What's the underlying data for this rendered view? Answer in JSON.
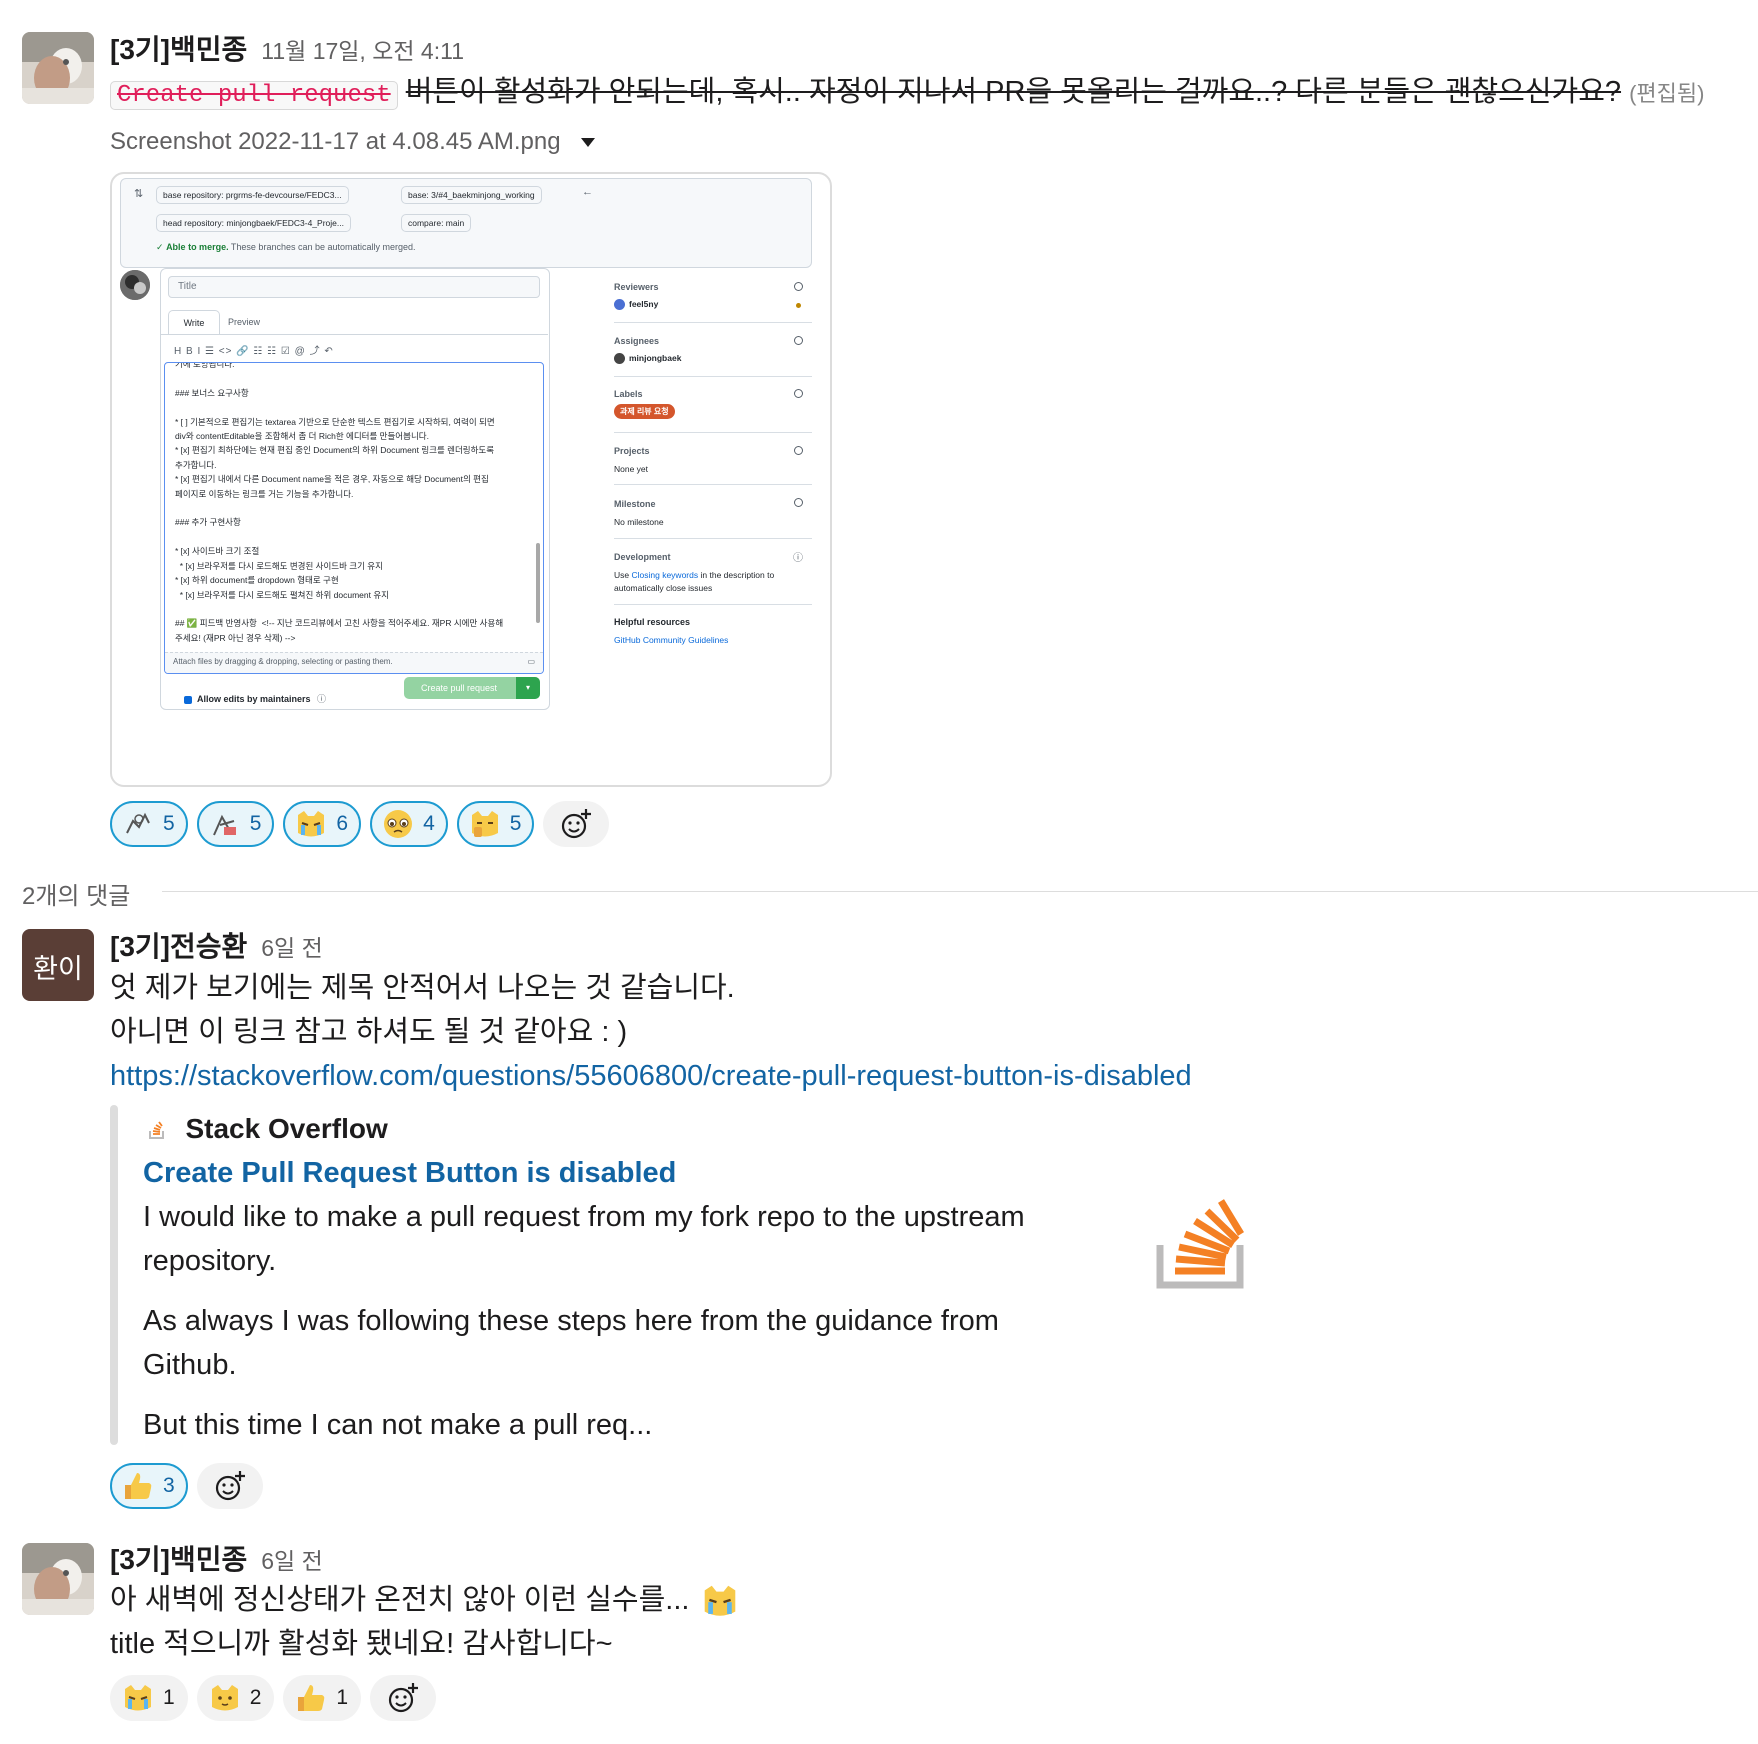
{
  "thread": {
    "parent": {
      "author": "[3기]백민종",
      "timestamp": "11월 17일, 오전 4:11",
      "code_text": "Create pull request",
      "text": "버튼이 활성화가 안되는데, 혹시.. 자정이 지나서 PR을 못올리는 걸까요..? 다른 분들은 괜찮으신가요?",
      "edited": "(편집됨)",
      "file_name": "Screenshot 2022-11-17 at 4.08.45 AM.png",
      "reactions": [
        {
          "emoji": "dance-character-emoji",
          "count": "5"
        },
        {
          "emoji": "dance-character-2-emoji",
          "count": "5"
        },
        {
          "emoji": "crying-cat-emoji",
          "count": "6"
        },
        {
          "emoji": "pleading-face-emoji",
          "count": "4"
        },
        {
          "emoji": "cat-thumbs-emoji",
          "count": "5"
        }
      ]
    },
    "replies_count_label": "2개의 댓글",
    "reply1": {
      "author": "[3기]전승환",
      "avatar_text": "환이",
      "timestamp": "6일 전",
      "line1": "엇 제가 보기에는 제목 안적어서 나오는 것 같습니다.",
      "line2": "아니면 이 링크 참고 하셔도 될 것 같아요 : )",
      "url": "https://stackoverflow.com/questions/55606800/create-pull-request-button-is-disabled",
      "unfurl": {
        "site": "Stack Overflow",
        "title": "Create Pull Request Button is disabled",
        "para1_line1": "I would like to make a pull request from my fork repo to the upstream",
        "para1_line2": "repository.",
        "para2_line1": "As always I was following these steps here from the guidance from",
        "para2_line2": "Github.",
        "para3": "But this time I can not make a pull req..."
      },
      "reactions": [
        {
          "emoji": "thumbs-up-emoji",
          "count": "3"
        }
      ]
    },
    "reply2": {
      "author": "[3기]백민종",
      "timestamp": "6일 전",
      "line1": "아 새벽에 정신상태가 온전치 않아 이런 실수를...",
      "line2": "title 적으니까 활성화 됐네요! 감사합니다~",
      "reactions": [
        {
          "emoji": "crying-cat-emoji",
          "count": "1"
        },
        {
          "emoji": "cat-emoji",
          "count": "2"
        },
        {
          "emoji": "thumbs-up-emoji",
          "count": "1"
        }
      ]
    }
  },
  "github_screenshot": {
    "base_repo": "base repository: prgrms-fe-devcourse/FEDC3...",
    "base": "base: 3/#4_baekminjong_working",
    "head_repo": "head repository: minjongbaek/FEDC3-4_Proje...",
    "compare": "compare: main",
    "merge_ok": "Able to merge.",
    "merge_note": "These branches can be automatically merged.",
    "title_placeholder": "Title",
    "tab_write": "Write",
    "tab_preview": "Preview",
    "toolbar": "H  B  I  ☰  <>  🔗  ☷  ☷  ☑  @  ⤴  ↶",
    "editor_lines": [
      "기에 토양됩니다.",
      "",
      "### 보너스 요구사항",
      "",
      "* [ ] 기본적으로 편집기는 textarea 기반으로 단순한 텍스트 편집기로 시작하되, 여력이 되면",
      "div와 contentEditable을 조합해서 좀 더 Rich한 에디터를 만들어봅니다.",
      "* [x] 편집기 최하단에는 현재 편집 중인 Document의 하위 Document 링크를 렌더링하도록",
      "추가합니다.",
      "* [x] 편집기 내에서 다른 Document name을 적은 경우, 자동으로 해당 Document의 편집",
      "페이지로 이동하는 링크를 거는 기능을 추가합니다.",
      "",
      "### 추가 구현사항",
      "",
      "* [x] 사이드바 크기 조절",
      "  * [x] 브라우저를 다시 로드해도 변경된 사이드바 크기 유지",
      "* [x] 하위 document를 dropdown 형태로 구현",
      "  * [x] 브라우저를 다시 로드해도 펼쳐진 하위 document 유지",
      "",
      "## ✅ 피드백 반영사항  <!-- 지난 코드리뷰에서 고친 사항을 적어주세요. 재PR 시에만 사용해",
      "주세요! (재PR 아닌 경우 삭제) -->"
    ],
    "attach_hint": "Attach files by dragging & dropping, selecting or pasting them.",
    "allow_edits": "Allow edits by maintainers",
    "create_btn": "Create pull request",
    "reviewers_h": "Reviewers",
    "reviewer": "feel5ny",
    "assignees_h": "Assignees",
    "assignee": "minjongbaek",
    "labels_h": "Labels",
    "label": "과제 리뷰 요청",
    "projects_h": "Projects",
    "projects_v": "None yet",
    "milestone_h": "Milestone",
    "milestone_v": "No milestone",
    "development_h": "Development",
    "dev_use": "Use",
    "dev_link": "Closing keywords",
    "dev_rest1": "in the description to",
    "dev_rest2": "automatically close issues",
    "helpful_h": "Helpful resources",
    "helpful_link": "GitHub Community Guidelines"
  },
  "colors": {
    "link": "#1264a3",
    "code_red": "#e01e5a",
    "so_orange": "#f48024",
    "gh_green": "#2da44e",
    "label_orange": "#d4562c",
    "avatar_brown": "#5a3e36"
  }
}
